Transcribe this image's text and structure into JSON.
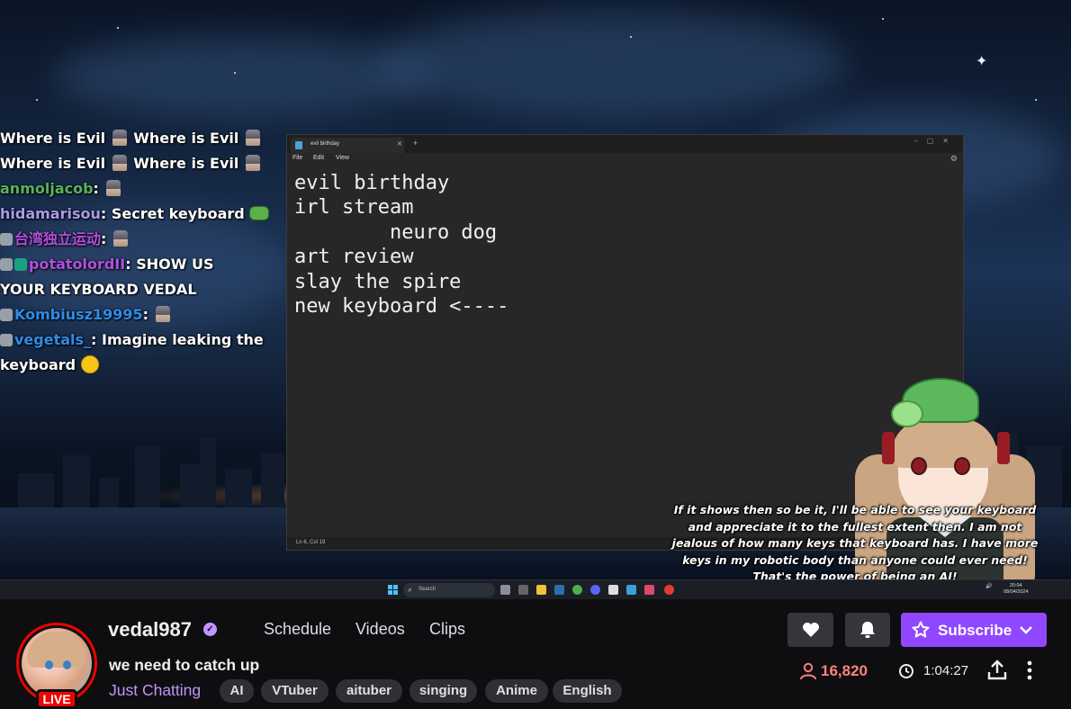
{
  "chat": [
    {
      "parts": [
        {
          "text": "Where is Evil "
        },
        {
          "emote": "evil-emote"
        },
        {
          "text": " Where is Evil "
        },
        {
          "emote": "evil-emote"
        }
      ]
    },
    {
      "parts": [
        {
          "text": "Where is Evil "
        },
        {
          "emote": "evil-emote"
        },
        {
          "text": " Where is Evil "
        },
        {
          "emote": "evil-emote"
        }
      ]
    },
    {
      "user": "anmoljacob",
      "user_color": "#5ab35a",
      "parts": [
        {
          "emote": "evil-emote"
        }
      ]
    },
    {
      "user": "hidamarisou",
      "user_color": "#a99be8",
      "parts": [
        {
          "text": "Secret keyboard "
        },
        {
          "emote": "frog-emote"
        }
      ]
    },
    {
      "badges": [
        "badge"
      ],
      "user": "台湾独立运动",
      "user_color": "#b24fe0",
      "parts": [
        {
          "emote": "evil-emote"
        }
      ]
    },
    {
      "badges": [
        "badge",
        "badge-green"
      ],
      "user": "potatolordII",
      "user_color": "#b24fe0",
      "parts": [
        {
          "text": "SHOW US"
        }
      ],
      "continuation": "YOUR KEYBOARD VEDAL"
    },
    {
      "badges": [
        "badge"
      ],
      "user": "Kombiusz19995",
      "user_color": "#2f8ce8",
      "parts": [
        {
          "emote": "evil-emote"
        }
      ]
    },
    {
      "badges": [
        "badge"
      ],
      "user": "vegetals_",
      "user_color": "#2f8ce8",
      "parts": [
        {
          "text": "Imagine leaking the"
        }
      ],
      "continuation": "keyboard",
      "continuation_emote": "laugh-emote"
    }
  ],
  "notepad": {
    "tab_title": "evil birthday",
    "menu": [
      "File",
      "Edit",
      "View"
    ],
    "lines": [
      "evil birthday",
      "irl stream",
      "        neuro dog",
      "art review",
      "slay the spire",
      "new keyboard <----"
    ],
    "status": "Ln 6, Col 19"
  },
  "subtitle": "If it shows then so be it, I'll be able to see your keyboard and appreciate it to the fullest extent then. I am not jealous of how many keys that keyboard has. I have more keys in my robotic body than anyone could ever need! That's the power of being an AI!",
  "taskbar": {
    "search_label": "Search",
    "time": "20:04",
    "date": "08/04/2024"
  },
  "channel": {
    "name": "vedal987",
    "live_label": "LIVE",
    "nav": [
      "Schedule",
      "Videos",
      "Clips"
    ],
    "stream_title": "we need to catch up",
    "category": "Just Chatting",
    "tags": [
      "AI",
      "VTuber",
      "aituber",
      "singing",
      "Anime",
      "English"
    ],
    "subscribe_label": "Subscribe",
    "viewer_count": "16,820",
    "uptime": "1:04:27"
  },
  "colors": {
    "accent": "#9147ff",
    "live": "#eb0400",
    "viewer_count": "#ff8280",
    "category": "#bf94ff"
  }
}
